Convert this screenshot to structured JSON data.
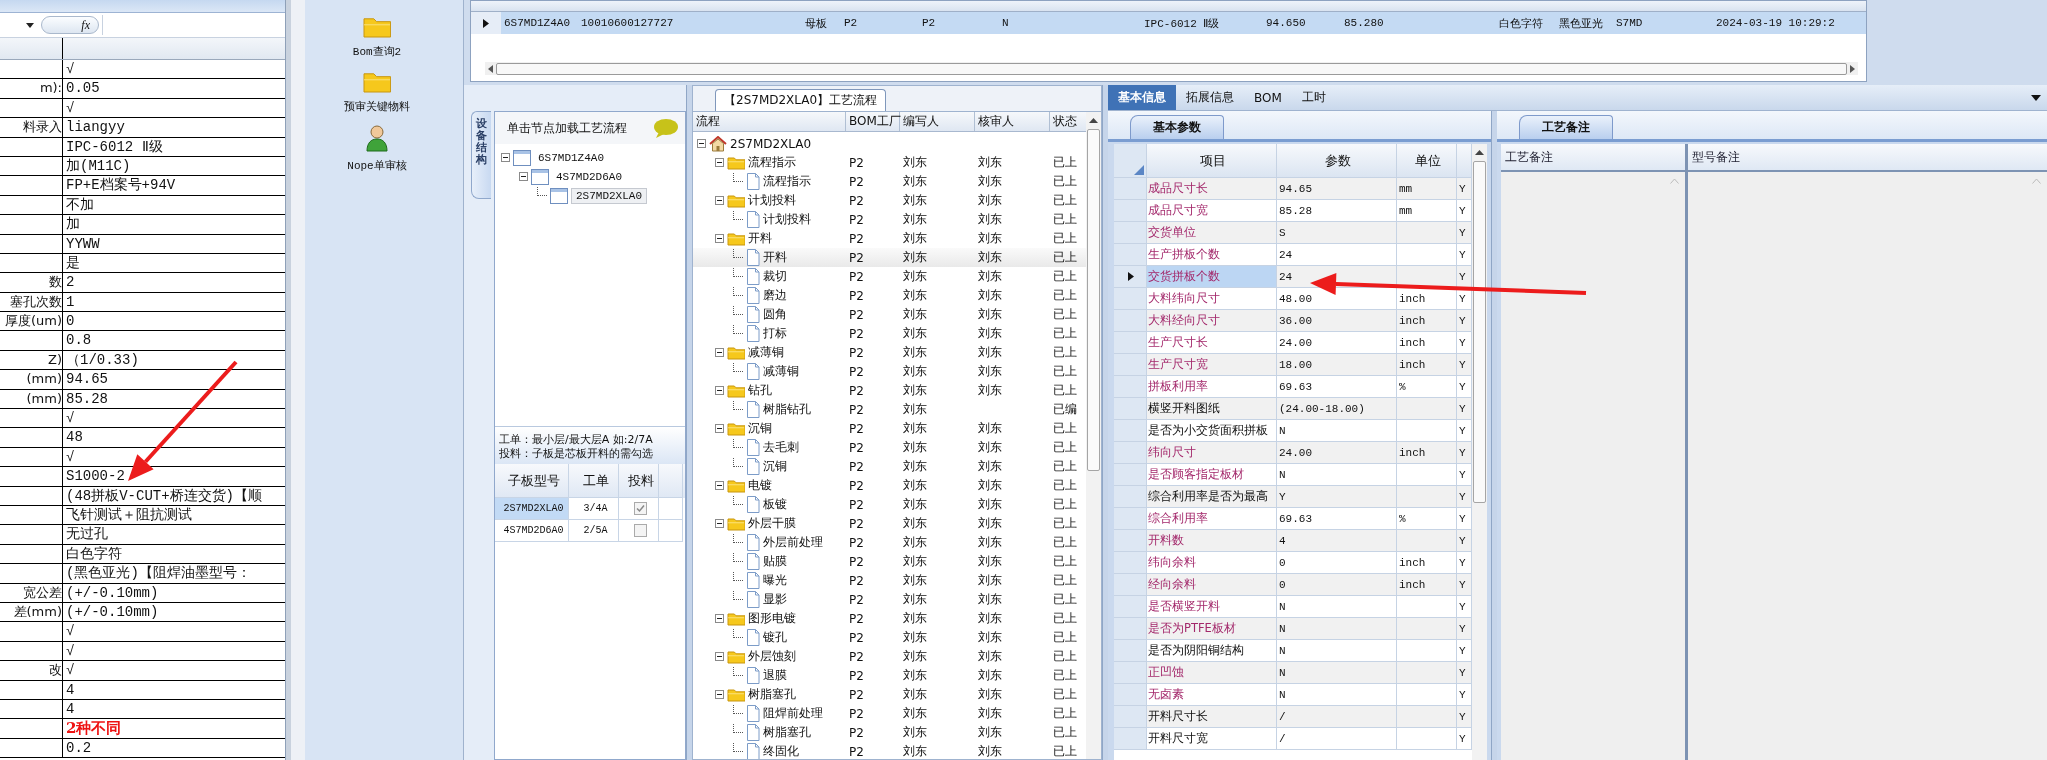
{
  "spreadsheet": {
    "formula_bar": {
      "function_button": "fx"
    },
    "rows": [
      {
        "label": "",
        "value": "√",
        "alert": false
      },
      {
        "label": "m):",
        "value": "0.05",
        "alert": false
      },
      {
        "label": "",
        "value": "√",
        "alert": false
      },
      {
        "label": "料录入",
        "value": "liangyy",
        "alert": false
      },
      {
        "label": "",
        "value": "IPC-6012 Ⅱ级",
        "alert": false
      },
      {
        "label": "",
        "value": "加(M11C)",
        "alert": false
      },
      {
        "label": "",
        "value": "FP+E档案号+94V",
        "alert": false
      },
      {
        "label": "",
        "value": "不加",
        "alert": false
      },
      {
        "label": "",
        "value": "加",
        "alert": false
      },
      {
        "label": "",
        "value": "YYWW",
        "alert": false
      },
      {
        "label": "",
        "value": "是",
        "alert": false
      },
      {
        "label": "数",
        "value": "2",
        "alert": false
      },
      {
        "label": "塞孔次数",
        "value": "1",
        "alert": false
      },
      {
        "label": "厚度(um)",
        "value": "0",
        "alert": false
      },
      {
        "label": "",
        "value": "0.8",
        "alert": false
      },
      {
        "label": "Z)",
        "value": "（1/0.33)",
        "alert": false
      },
      {
        "label": "(mm)",
        "value": "94.65",
        "alert": false
      },
      {
        "label": "(mm)",
        "value": "85.28",
        "alert": false
      },
      {
        "label": "",
        "value": "√",
        "alert": false
      },
      {
        "label": "",
        "value": "48",
        "alert": false
      },
      {
        "label": "",
        "value": "√",
        "alert": false
      },
      {
        "label": "",
        "value": "S1000-2",
        "alert": false
      },
      {
        "label": "",
        "value": "(48拼板V-CUT+桥连交货)【顺",
        "alert": false
      },
      {
        "label": "",
        "value": "飞针测试＋阻抗测试",
        "alert": false
      },
      {
        "label": "",
        "value": "无过孔",
        "alert": false
      },
      {
        "label": "",
        "value": "白色字符",
        "alert": false
      },
      {
        "label": "",
        "value": "(黑色亚光)【阻焊油墨型号：",
        "alert": false
      },
      {
        "label": "宽公差",
        "value": "(+/-0.10mm)",
        "alert": false
      },
      {
        "label": "差(mm)",
        "value": "(+/-0.10mm)",
        "alert": false
      },
      {
        "label": "",
        "value": "√",
        "alert": false
      },
      {
        "label": "",
        "value": "√",
        "alert": false
      },
      {
        "label": "改",
        "value": "√",
        "alert": false
      },
      {
        "label": "",
        "value": "4",
        "alert": false
      },
      {
        "label": "",
        "value": "4",
        "alert": false
      },
      {
        "label": "",
        "value": "2种不同",
        "alert": true
      },
      {
        "label": "",
        "value": "0.2",
        "alert": false
      }
    ]
  },
  "launcher": {
    "items": [
      {
        "label": "Bom查询2",
        "kind": "folder"
      },
      {
        "label": "预审关键物料",
        "kind": "folder"
      },
      {
        "label": "Nope单审核",
        "kind": "person"
      }
    ]
  },
  "top_grid": {
    "rows": [
      {
        "selected": true,
        "cells": [
          "6S7MD1Z4A0",
          "10010600127727",
          "母板",
          "P2",
          "P2",
          "N",
          "IPC-6012 Ⅱ级",
          "94.650",
          "85.280",
          "白色字符",
          "黑色亚光",
          "S7MD",
          "2024-03-19 10:29:2"
        ]
      }
    ]
  },
  "structure_panel": {
    "side_tab": "设备结构",
    "hint": "单击节点加载工艺流程",
    "tree": [
      {
        "label": "6S7MD1Z4A0",
        "expanded": true,
        "selected": false,
        "children": [
          {
            "label": "4S7MD2D6A0",
            "expanded": true,
            "selected": false,
            "children": [
              {
                "label": "2S7MD2XLA0",
                "selected": true
              }
            ]
          }
        ]
      }
    ],
    "notes": [
      "工单：最小层/最大层A 如:2/7A",
      "投料：子板是芯板开料的需勾选"
    ],
    "table": {
      "columns": [
        "子板型号",
        "工单",
        "投料"
      ],
      "rows": [
        {
          "model": "2S7MD2XLA0",
          "order": "3/4A",
          "checked": true,
          "selected": true
        },
        {
          "model": "4S7MD2D6A0",
          "order": "2/5A",
          "checked": false,
          "selected": false
        }
      ]
    }
  },
  "process_panel": {
    "title": "【2S7MD2XLA0】工艺流程",
    "columns": [
      "流程",
      "BOM工厂",
      "编写人",
      "核审人",
      "状态"
    ],
    "tree": [
      {
        "label": "2S7MD2XLA0",
        "kind": "root",
        "expanded": true,
        "selected": false,
        "children": [
          {
            "label": "流程指示",
            "kind": "folder",
            "expanded": true,
            "selected": false,
            "bom": "P2",
            "writer": "刘东",
            "reviewer": "刘东",
            "status": "已上",
            "children": [
              {
                "label": "流程指示",
                "kind": "step",
                "selected": false,
                "bom": "P2",
                "writer": "刘东",
                "reviewer": "刘东",
                "status": "已上"
              }
            ]
          },
          {
            "label": "计划投料",
            "kind": "folder",
            "expanded": true,
            "selected": false,
            "bom": "P2",
            "writer": "刘东",
            "reviewer": "刘东",
            "status": "已上",
            "children": [
              {
                "label": "计划投料",
                "kind": "step",
                "selected": false,
                "bom": "P2",
                "writer": "刘东",
                "reviewer": "刘东",
                "status": "已上"
              }
            ]
          },
          {
            "label": "开料",
            "kind": "folder",
            "expanded": true,
            "selected": false,
            "bom": "P2",
            "writer": "刘东",
            "reviewer": "刘东",
            "status": "已上",
            "children": [
              {
                "label": "开料",
                "kind": "step",
                "selected": true,
                "bom": "P2",
                "writer": "刘东",
                "reviewer": "刘东",
                "status": "已上"
              },
              {
                "label": "裁切",
                "kind": "step",
                "selected": false,
                "bom": "P2",
                "writer": "刘东",
                "reviewer": "刘东",
                "status": "已上"
              },
              {
                "label": "磨边",
                "kind": "step",
                "selected": false,
                "bom": "P2",
                "writer": "刘东",
                "reviewer": "刘东",
                "status": "已上"
              },
              {
                "label": "圆角",
                "kind": "step",
                "selected": false,
                "bom": "P2",
                "writer": "刘东",
                "reviewer": "刘东",
                "status": "已上"
              },
              {
                "label": "打标",
                "kind": "step",
                "selected": false,
                "bom": "P2",
                "writer": "刘东",
                "reviewer": "刘东",
                "status": "已上"
              }
            ]
          },
          {
            "label": "减薄铜",
            "kind": "folder",
            "expanded": true,
            "selected": false,
            "bom": "P2",
            "writer": "刘东",
            "reviewer": "刘东",
            "status": "已上",
            "children": [
              {
                "label": "减薄铜",
                "kind": "step",
                "selected": false,
                "bom": "P2",
                "writer": "刘东",
                "reviewer": "刘东",
                "status": "已上"
              }
            ]
          },
          {
            "label": "钻孔",
            "kind": "folder",
            "expanded": true,
            "selected": false,
            "bom": "P2",
            "writer": "刘东",
            "reviewer": "刘东",
            "status": "已上",
            "children": [
              {
                "label": "树脂钻孔",
                "kind": "step",
                "selected": false,
                "bom": "P2",
                "writer": "刘东",
                "status": "已编"
              }
            ]
          },
          {
            "label": "沉铜",
            "kind": "folder",
            "expanded": true,
            "selected": false,
            "bom": "P2",
            "writer": "刘东",
            "reviewer": "刘东",
            "status": "已上",
            "children": [
              {
                "label": "去毛刺",
                "kind": "step",
                "selected": false,
                "bom": "P2",
                "writer": "刘东",
                "reviewer": "刘东",
                "status": "已上"
              },
              {
                "label": "沉铜",
                "kind": "step",
                "selected": false,
                "bom": "P2",
                "writer": "刘东",
                "reviewer": "刘东",
                "status": "已上"
              }
            ]
          },
          {
            "label": "电镀",
            "kind": "folder",
            "expanded": true,
            "selected": false,
            "bom": "P2",
            "writer": "刘东",
            "reviewer": "刘东",
            "status": "已上",
            "children": [
              {
                "label": "板镀",
                "kind": "step",
                "selected": false,
                "bom": "P2",
                "writer": "刘东",
                "reviewer": "刘东",
                "status": "已上"
              }
            ]
          },
          {
            "label": "外层干膜",
            "kind": "folder",
            "expanded": true,
            "selected": false,
            "bom": "P2",
            "writer": "刘东",
            "reviewer": "刘东",
            "status": "已上",
            "children": [
              {
                "label": "外层前处理",
                "kind": "step",
                "selected": false,
                "bom": "P2",
                "writer": "刘东",
                "reviewer": "刘东",
                "status": "已上"
              },
              {
                "label": "贴膜",
                "kind": "step",
                "selected": false,
                "bom": "P2",
                "writer": "刘东",
                "reviewer": "刘东",
                "status": "已上"
              },
              {
                "label": "曝光",
                "kind": "step",
                "selected": false,
                "bom": "P2",
                "writer": "刘东",
                "reviewer": "刘东",
                "status": "已上"
              },
              {
                "label": "显影",
                "kind": "step",
                "selected": false,
                "bom": "P2",
                "writer": "刘东",
                "reviewer": "刘东",
                "status": "已上"
              }
            ]
          },
          {
            "label": "图形电镀",
            "kind": "folder",
            "expanded": true,
            "selected": false,
            "bom": "P2",
            "writer": "刘东",
            "reviewer": "刘东",
            "status": "已上",
            "children": [
              {
                "label": "镀孔",
                "kind": "step",
                "selected": false,
                "bom": "P2",
                "writer": "刘东",
                "reviewer": "刘东",
                "status": "已上"
              }
            ]
          },
          {
            "label": "外层蚀刻",
            "kind": "folder",
            "expanded": true,
            "selected": false,
            "bom": "P2",
            "writer": "刘东",
            "reviewer": "刘东",
            "status": "已上",
            "children": [
              {
                "label": "退膜",
                "kind": "step",
                "selected": false,
                "bom": "P2",
                "writer": "刘东",
                "reviewer": "刘东",
                "status": "已上"
              }
            ]
          },
          {
            "label": "树脂塞孔",
            "kind": "folder",
            "expanded": true,
            "selected": false,
            "bom": "P2",
            "writer": "刘东",
            "reviewer": "刘东",
            "status": "已上",
            "children": [
              {
                "label": "阻焊前处理",
                "kind": "step",
                "selected": false,
                "bom": "P2",
                "writer": "刘东",
                "reviewer": "刘东",
                "status": "已上"
              },
              {
                "label": "树脂塞孔",
                "kind": "step",
                "selected": false,
                "bom": "P2",
                "writer": "刘东",
                "reviewer": "刘东",
                "status": "已上"
              },
              {
                "label": "终固化",
                "kind": "step",
                "selected": false,
                "bom": "P2",
                "writer": "刘东",
                "reviewer": "刘东",
                "status": "已上"
              }
            ]
          }
        ]
      }
    ]
  },
  "detail_tabs": [
    {
      "label": "基本信息",
      "selected": true
    },
    {
      "label": "拓展信息",
      "selected": false
    },
    {
      "label": "BOM",
      "selected": false
    },
    {
      "label": "工时",
      "selected": false
    }
  ],
  "params": {
    "tab": "基本参数",
    "columns": [
      "项目",
      "参数",
      "单位"
    ],
    "rows": [
      {
        "item": "成品尺寸长",
        "value": "94.65",
        "unit": "mm",
        "flag": "Y",
        "highlight": true,
        "selected": false
      },
      {
        "item": "成品尺寸宽",
        "value": "85.28",
        "unit": "mm",
        "flag": "Y",
        "highlight": true,
        "selected": false
      },
      {
        "item": "交货单位",
        "value": "S",
        "flag": "Y",
        "highlight": true,
        "selected": false
      },
      {
        "item": "生产拼板个数",
        "value": "24",
        "flag": "Y",
        "highlight": true,
        "selected": false
      },
      {
        "item": "交货拼板个数",
        "value": "24",
        "flag": "Y",
        "highlight": true,
        "selected": true
      },
      {
        "item": "大料纬向尺寸",
        "value": "48.00",
        "unit": "inch",
        "flag": "Y",
        "highlight": true,
        "selected": false
      },
      {
        "item": "大料经向尺寸",
        "value": "36.00",
        "unit": "inch",
        "flag": "Y",
        "highlight": true,
        "selected": false
      },
      {
        "item": "生产尺寸长",
        "value": "24.00",
        "unit": "inch",
        "flag": "Y",
        "highlight": true,
        "selected": false
      },
      {
        "item": "生产尺寸宽",
        "value": "18.00",
        "unit": "inch",
        "flag": "Y",
        "highlight": true,
        "selected": false
      },
      {
        "item": "拼板利用率",
        "value": "69.63",
        "unit": "%",
        "flag": "Y",
        "highlight": true,
        "selected": false
      },
      {
        "item": "横竖开料图纸",
        "value": "(24.00-18.00)",
        "flag": "Y",
        "highlight": false,
        "selected": false
      },
      {
        "item": "是否为小交货面积拼板",
        "value": "N",
        "flag": "Y",
        "highlight": false,
        "selected": false
      },
      {
        "item": "纬向尺寸",
        "value": "24.00",
        "unit": "inch",
        "flag": "Y",
        "highlight": true,
        "selected": false
      },
      {
        "item": "是否顾客指定板材",
        "value": "N",
        "flag": "Y",
        "highlight": true,
        "selected": false
      },
      {
        "item": "综合利用率是否为最高",
        "value": "Y",
        "flag": "Y",
        "highlight": false,
        "selected": false
      },
      {
        "item": "综合利用率",
        "value": "69.63",
        "unit": "%",
        "flag": "Y",
        "highlight": true,
        "selected": false
      },
      {
        "item": "开料数",
        "value": "4",
        "flag": "Y",
        "highlight": true,
        "selected": false
      },
      {
        "item": "纬向余料",
        "value": "0",
        "unit": "inch",
        "flag": "Y",
        "highlight": true,
        "selected": false
      },
      {
        "item": "经向余料",
        "value": "0",
        "unit": "inch",
        "flag": "Y",
        "highlight": true,
        "selected": false
      },
      {
        "item": "是否横竖开料",
        "value": "N",
        "flag": "Y",
        "highlight": true,
        "selected": false
      },
      {
        "item": "是否为PTFE板材",
        "value": "N",
        "flag": "Y",
        "highlight": true,
        "selected": false
      },
      {
        "item": "是否为阴阳铜结构",
        "value": "N",
        "flag": "Y",
        "highlight": false,
        "selected": false
      },
      {
        "item": "正凹蚀",
        "value": "N",
        "flag": "Y",
        "highlight": true,
        "selected": false
      },
      {
        "item": "无卤素",
        "value": "N",
        "flag": "Y",
        "highlight": true,
        "selected": false
      },
      {
        "item": "开料尺寸长",
        "value": "/",
        "flag": "Y",
        "highlight": false,
        "selected": false
      },
      {
        "item": "开料尺寸宽",
        "value": "/",
        "flag": "Y",
        "highlight": false,
        "selected": false
      }
    ]
  },
  "notes_panel": {
    "tab": "工艺备注",
    "columns": [
      "工艺备注",
      "型号备注"
    ]
  }
}
